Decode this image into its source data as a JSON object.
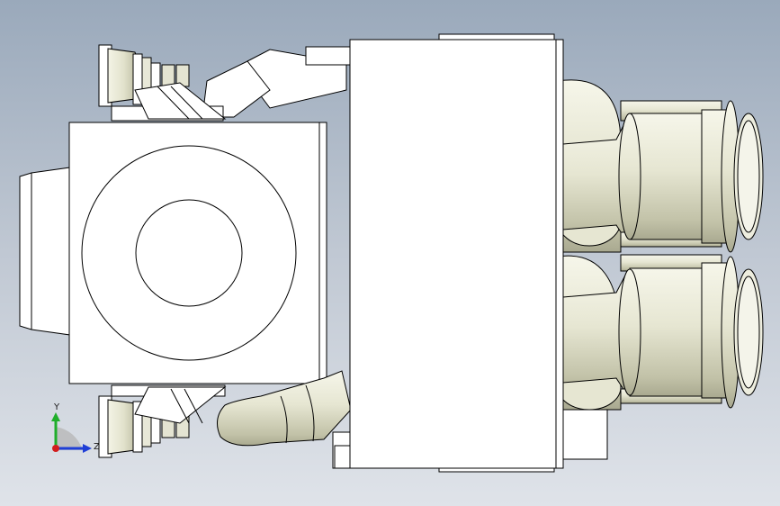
{
  "viewport": {
    "background_top": "#9aa9bb",
    "background_bottom": "#dfe3e9"
  },
  "model": {
    "body_fill": "#ffffff",
    "edge_color": "#000000",
    "fitting_fill": "#e9e9d9",
    "fitting_shade": "#b9b99f"
  },
  "triad": {
    "x_axis_label": "",
    "y_axis_label": "Y",
    "z_axis_label": "Z",
    "y_color": "#1fae2a",
    "z_color": "#1f3fd6",
    "x_color": "#d21d1d"
  }
}
